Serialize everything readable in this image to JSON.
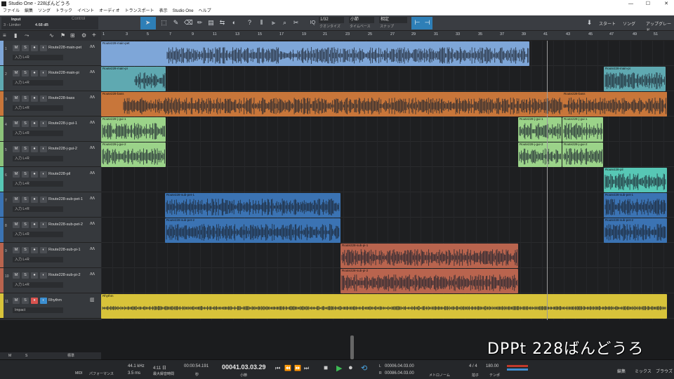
{
  "window": {
    "title": "Studio One - 228ばんどうろ"
  },
  "menu": [
    "ファイル",
    "編集",
    "ソング",
    "トラック",
    "イベント",
    "オーディオ",
    "トランスポート",
    "表示",
    "Studio One",
    "ヘルプ"
  ],
  "inspector": {
    "input_label": "Input",
    "device": "3 - Limiter",
    "gain": "4.68 dB",
    "control_label": "Control"
  },
  "toolbar": {
    "quantize_value": "1/32",
    "quantize_label": "クオンタイズ",
    "timebase_value": "小節",
    "timebase_label": "タイムベース",
    "snap_value": "相定",
    "snap_label": "スナップ",
    "start_label": "スタート",
    "song_label": "ソング",
    "upgrade_label": "アップグレード"
  },
  "ruler": [
    "1",
    "3",
    "5",
    "7",
    "9",
    "11",
    "13",
    "15",
    "17",
    "19",
    "21",
    "23",
    "25",
    "27",
    "29",
    "31",
    "33",
    "35",
    "37",
    "39",
    "41",
    "43",
    "45",
    "47",
    "49",
    "51"
  ],
  "tracks": [
    {
      "num": "1",
      "name": "Route228-main-pet",
      "input": "入力 L+R",
      "color": "#7ea6d8"
    },
    {
      "num": "2",
      "name": "Route228-main-pi",
      "input": "入力 L+R",
      "color": "#5fa9b1"
    },
    {
      "num": "3",
      "name": "Route228-bass",
      "input": "入力 L+R",
      "color": "#c8763a"
    },
    {
      "num": "4",
      "name": "Route228-j-gui-1",
      "input": "入力 L+R",
      "color": "#8cc27a"
    },
    {
      "num": "5",
      "name": "Route228-j-gui-2",
      "input": "入力 L+R",
      "color": "#8cc27a"
    },
    {
      "num": "6",
      "name": "Route228-pil",
      "input": "入力 L+R",
      "color": "#57c7b5"
    },
    {
      "num": "7",
      "name": "Route228-sub-pet-1",
      "input": "入力 L+R",
      "color": "#3b73b3"
    },
    {
      "num": "8",
      "name": "Route228-sub-pet-2",
      "input": "入力 L+R",
      "color": "#3b73b3"
    },
    {
      "num": "9",
      "name": "Route228-sub-pi-1",
      "input": "入力 L+R",
      "color": "#b9644e"
    },
    {
      "num": "10",
      "name": "Route228-sub-pi-2",
      "input": "入力 L+R",
      "color": "#b9644e"
    },
    {
      "num": "11",
      "name": "Rhythm",
      "input": "Impact",
      "color": "#d8c33a"
    }
  ],
  "clips": [
    {
      "track": 0,
      "name": "Route228-main-pet",
      "color": "#7ea6d8"
    },
    {
      "track": 1,
      "name": "Route228-main-pi",
      "color": "#5fa9b1"
    },
    {
      "track": 1,
      "name": "Route228-main-pi",
      "color": "#5fa9b1"
    },
    {
      "track": 2,
      "name": "Route228-bass",
      "color": "#c8763a"
    },
    {
      "track": 2,
      "name": "Route228-bass",
      "color": "#c8763a"
    },
    {
      "track": 3,
      "name": "Route228-j-gui-1",
      "color": "#9bd389"
    },
    {
      "track": 3,
      "name": "Route228-j-gui-1",
      "color": "#9bd389"
    },
    {
      "track": 3,
      "name": "Route228-j-gui-1",
      "color": "#9bd389"
    },
    {
      "track": 4,
      "name": "Route228-j-gui-2",
      "color": "#9bd389"
    },
    {
      "track": 4,
      "name": "Route228-j-gui-2",
      "color": "#9bd389"
    },
    {
      "track": 4,
      "name": "Route228-j-gui-2",
      "color": "#9bd389"
    },
    {
      "track": 5,
      "name": "Route228-pil",
      "color": "#57c7b5"
    },
    {
      "track": 6,
      "name": "Route228-sub-pet-1",
      "color": "#3b73b3"
    },
    {
      "track": 6,
      "name": "Route228-sub-pet-1",
      "color": "#3b73b3"
    },
    {
      "track": 7,
      "name": "Route228-sub-pet-2",
      "color": "#3b73b3"
    },
    {
      "track": 7,
      "name": "Route228-sub-pet-2",
      "color": "#3b73b3"
    },
    {
      "track": 8,
      "name": "Route228-sub-pi-1",
      "color": "#b9644e"
    },
    {
      "track": 9,
      "name": "Route228-sub-pi-2",
      "color": "#b9644e"
    },
    {
      "track": 10,
      "name": "Rhythm",
      "color": "#d8c33a"
    }
  ],
  "bottom_tabs": {
    "m": "M",
    "s": "S",
    "std": "標準"
  },
  "transport": {
    "midi_label": "MIDI",
    "perf_label": "パフォーマンス",
    "sample_rate": "44.1 kHz",
    "latency": "3.5 ms",
    "rec_time": "4:11 日",
    "rec_label": "最大録音時間",
    "seconds": "00:00:54.191",
    "seconds_label": "秒",
    "position": "00041.03.03.29",
    "position_label": "小節",
    "loop_l": "00006.04.03.00",
    "loop_r": "00086.04.03.00",
    "metronome_label": "メトロノーム",
    "timesig": "4 / 4",
    "timesig_label": "拍子",
    "tempo": "180.00",
    "tempo_label": "テンポ",
    "edit_label": "編集",
    "mix_label": "ミックス",
    "browse_label": "ブラウズ"
  },
  "watermark": "DPPt 228ばんどうろ"
}
